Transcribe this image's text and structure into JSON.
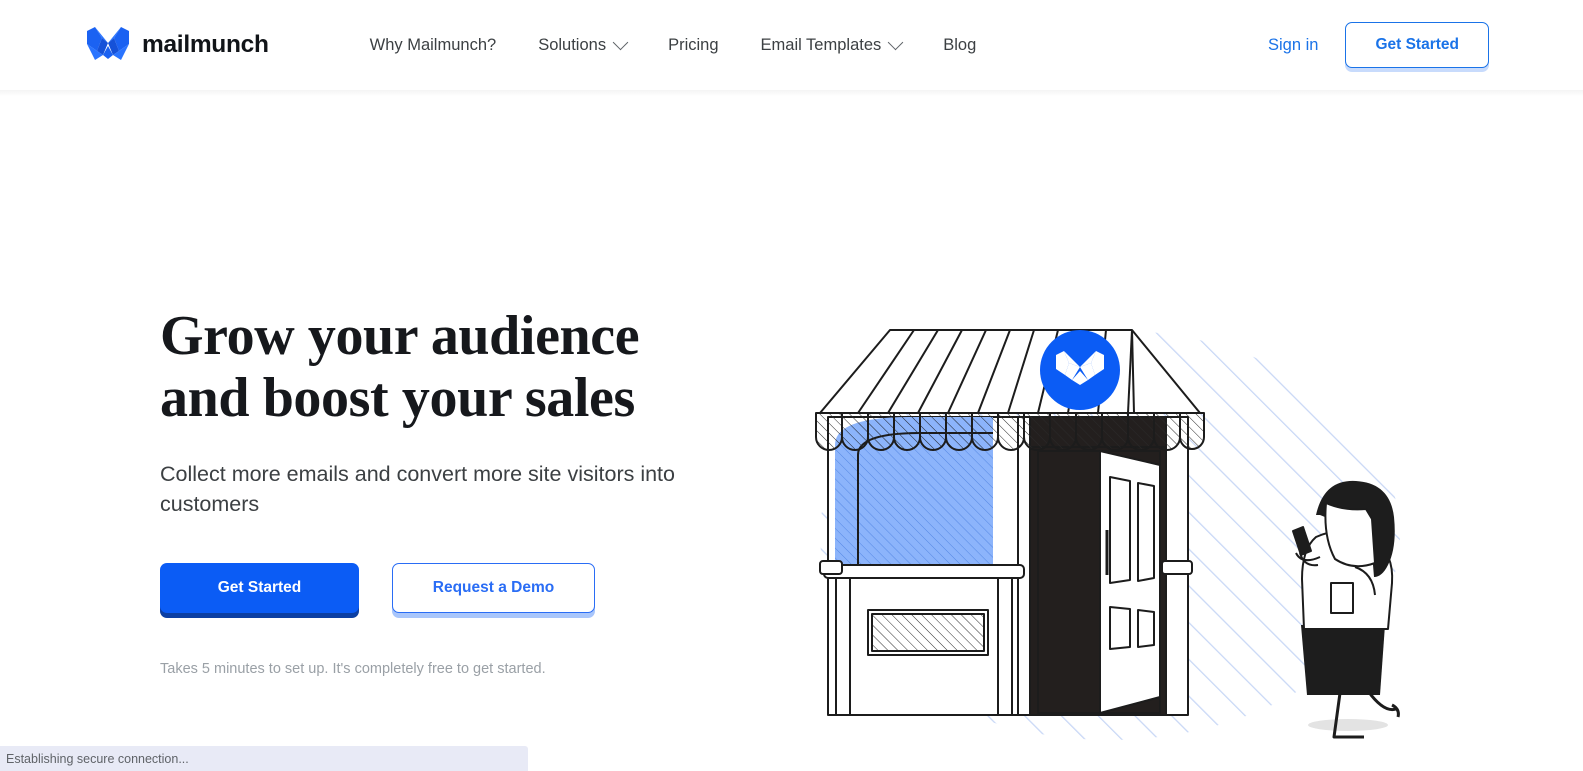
{
  "brand": {
    "name": "mailmunch",
    "logo_icon": "mailmunch-m-logo",
    "accent_blue": "#0b5cf5",
    "link_blue": "#1a73e8"
  },
  "header": {
    "nav_items": [
      {
        "label": "Why Mailmunch?",
        "has_dropdown": false
      },
      {
        "label": "Solutions",
        "has_dropdown": true
      },
      {
        "label": "Pricing",
        "has_dropdown": false
      },
      {
        "label": "Email Templates",
        "has_dropdown": true
      },
      {
        "label": "Blog",
        "has_dropdown": false
      }
    ],
    "signin_label": "Sign in",
    "get_started_label": "Get Started"
  },
  "hero": {
    "heading_line1": "Grow your audience",
    "heading_line2": "and boost your sales",
    "subheading": "Collect more emails and convert more site visitors into customers",
    "primary_cta": "Get Started",
    "secondary_cta": "Request a Demo",
    "fine_print": "Takes 5 minutes to set up. It's completely free to get started."
  },
  "illustration": {
    "name": "storefront-illustration",
    "description": "Line-art storefront with striped awning, blue badge logo, blue display window, open door, and a woman walking while holding a phone",
    "badge_color": "#0b5cf5",
    "window_color": "#8cb4fb",
    "hatch_color": "#c6d6f5"
  },
  "statusbar": {
    "text": "Establishing secure connection..."
  }
}
